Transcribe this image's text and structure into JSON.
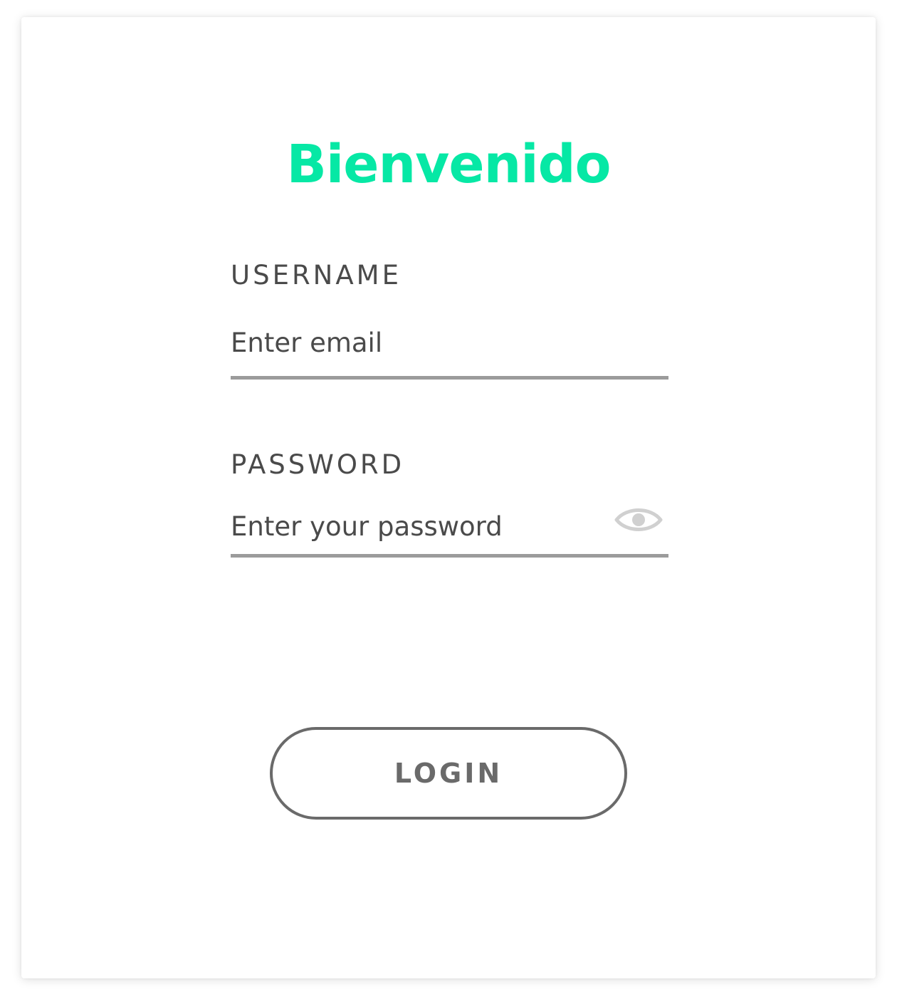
{
  "login_card": {
    "title": "Bienvenido",
    "username": {
      "label": "USERNAME",
      "placeholder": "Enter email",
      "value": ""
    },
    "password": {
      "label": "PASSWORD",
      "placeholder": "Enter your password",
      "value": "",
      "toggle_icon": "eye-icon"
    },
    "login_button": {
      "label": "LOGIN"
    }
  },
  "colors": {
    "accent": "#06e8a5",
    "text": "#4a4a4a",
    "underline": "#9b9b9b",
    "button_border": "#6a6a6a",
    "icon": "#d0d0d0"
  }
}
